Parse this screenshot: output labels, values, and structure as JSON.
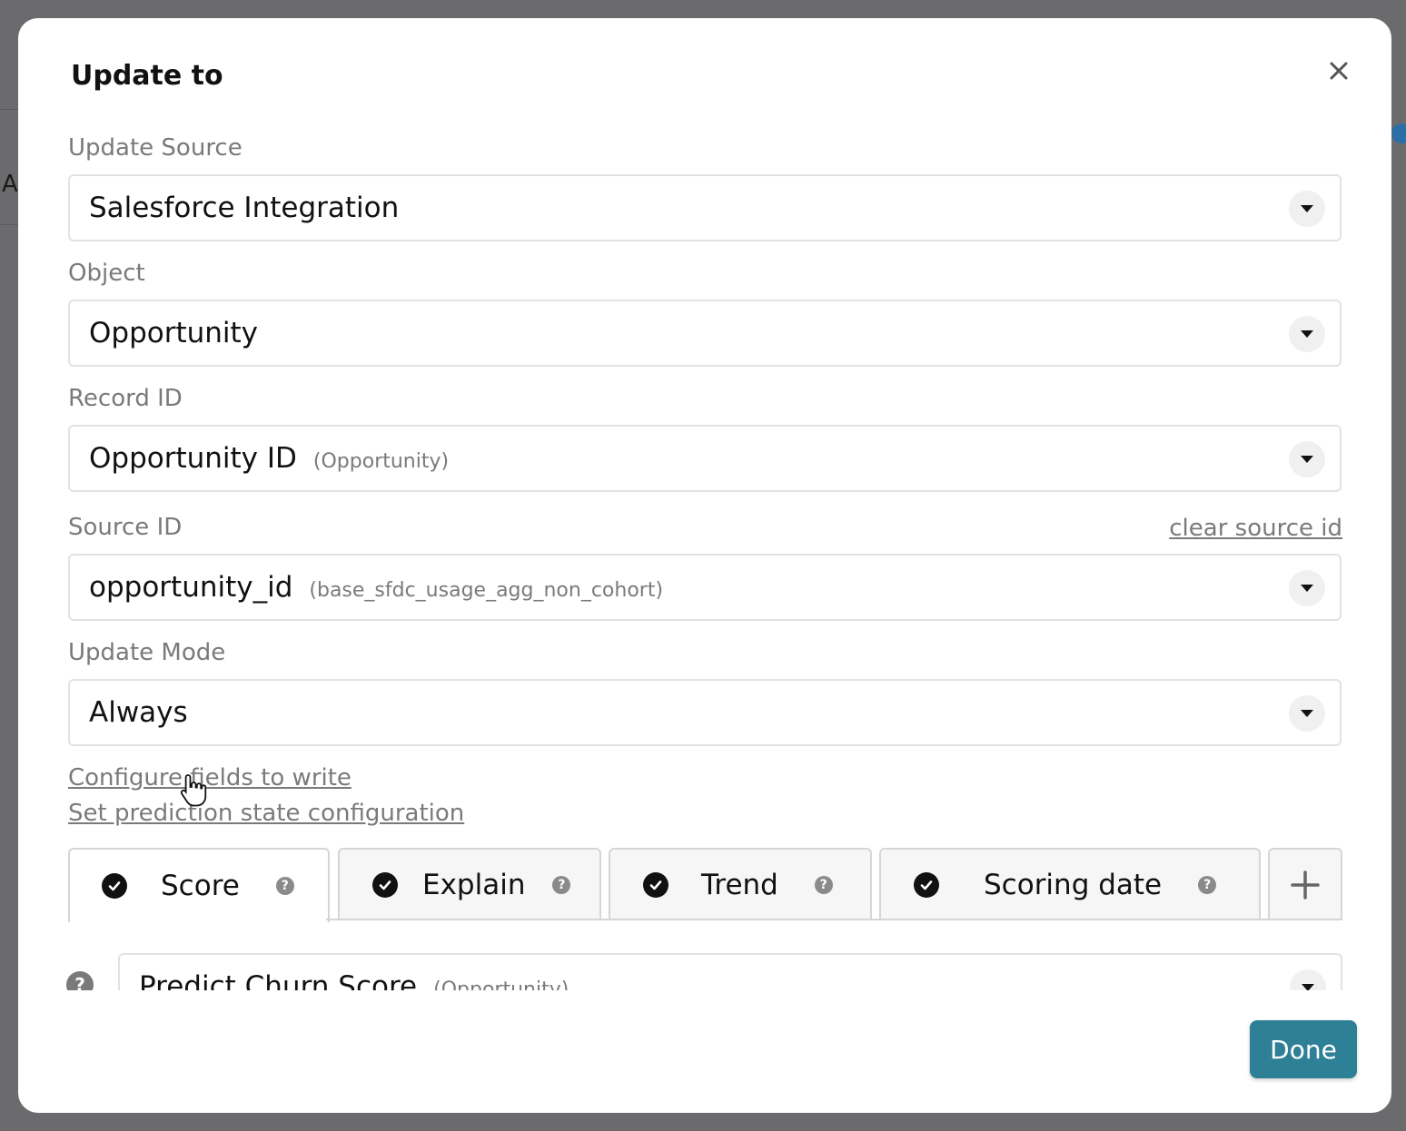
{
  "backdrop": {
    "letter": "A"
  },
  "modal": {
    "title": "Update to",
    "fields": [
      {
        "label": "Update Source",
        "value": "Salesforce Integration",
        "sub": ""
      },
      {
        "label": "Object",
        "value": "Opportunity",
        "sub": ""
      },
      {
        "label": "Record ID",
        "value": "Opportunity ID",
        "sub": "(Opportunity)"
      },
      {
        "label": "Source ID",
        "value": "opportunity_id",
        "sub": "(base_sfdc_usage_agg_non_cohort)"
      },
      {
        "label": "Update Mode",
        "value": "Always",
        "sub": ""
      }
    ],
    "clear_source_id": "clear source id",
    "links": {
      "configure_fields": "Configure fields to write",
      "prediction_state": "Set prediction state configuration"
    },
    "tabs": [
      {
        "label": "Score",
        "active": true
      },
      {
        "label": "Explain",
        "active": false
      },
      {
        "label": "Trend",
        "active": false
      },
      {
        "label": "Scoring date",
        "active": false
      }
    ],
    "mapping_row": {
      "value": "Predict Churn Score",
      "sub": "(Opportunity)"
    },
    "done_label": "Done"
  },
  "colors": {
    "primary": "#2e8096",
    "overlay": "#6b6b6d",
    "muted_text": "#7a7a7a"
  },
  "icons": [
    "close-icon",
    "chevron-down-icon",
    "check-circle-icon",
    "help-icon",
    "plus-icon",
    "pointer-cursor-icon"
  ]
}
